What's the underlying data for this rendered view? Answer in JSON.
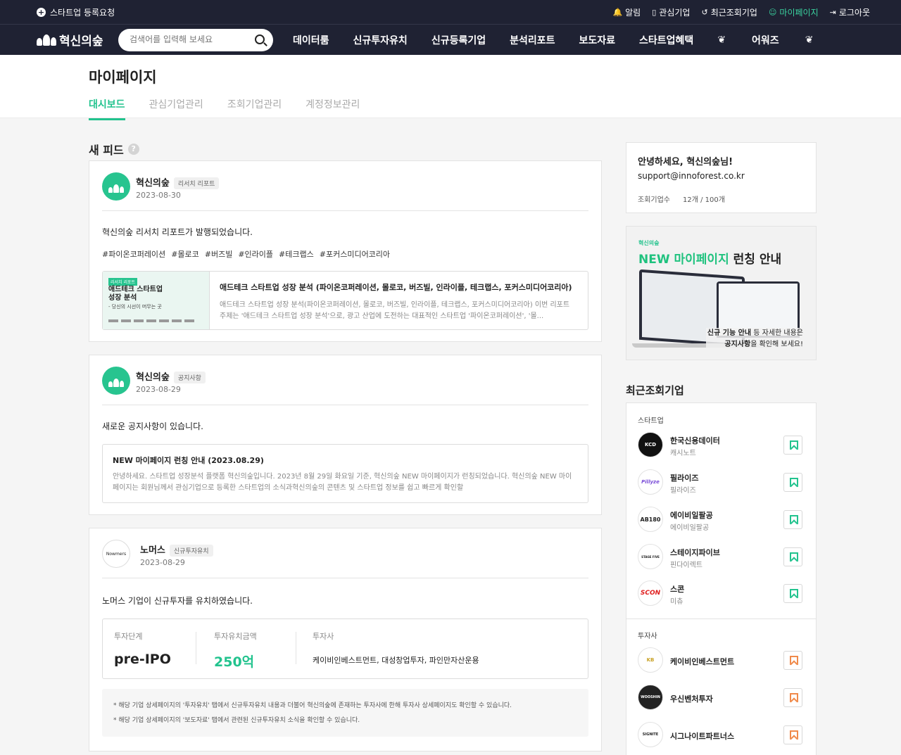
{
  "topbar": {
    "register": "스타트업 등록요청",
    "links": [
      {
        "icon": "bell-icon",
        "label": "알림"
      },
      {
        "icon": "bookmark-icon",
        "label": "관심기업"
      },
      {
        "icon": "history-icon",
        "label": "최근조회기업"
      },
      {
        "icon": "user-icon",
        "label": "마이페이지"
      },
      {
        "icon": "logout-icon",
        "label": "로그아웃"
      }
    ]
  },
  "nav": {
    "logo": "혁신의숲",
    "search_placeholder": "검색어를 입력해 보세요",
    "menu": [
      "데이터룸",
      "신규투자유치",
      "신규등록기업",
      "분석리포트",
      "보도자료",
      "스타트업혜택",
      "어워즈"
    ]
  },
  "page": {
    "title": "마이페이지",
    "tabs": [
      "대시보드",
      "관심기업관리",
      "조회기업관리",
      "계정정보관리"
    ]
  },
  "feed": {
    "title": "새 피드",
    "help": "?",
    "items": [
      {
        "author": "혁신의숲",
        "badge": "리서치 리포트",
        "date": "2023-08-30",
        "message": "혁신의숲 리서치 리포트가 발행되었습니다.",
        "tags": [
          "#파이온코퍼레이션",
          "#몰로코",
          "#버즈빌",
          "#인라이플",
          "#테크랩스",
          "#포커스미디어코리아"
        ],
        "thumb": {
          "label": "리서치 리포트",
          "title_line1": "애드테크 스타트업",
          "title_line2": "성장 분석",
          "sub": "- 당신의 시선이 머무는 곳"
        },
        "link_title": "애드테크 스타트업 성장 분석 (파이온코퍼레이션, 몰로코, 버즈빌, 인라이플, 테크랩스, 포커스미디어코리아)",
        "link_desc": "애드테크 스타트업 성장 분석(파이온코퍼레이션, 몰로코, 버즈빌, 인라이플, 테크랩스, 포커스미디어코리아) 이번 리포트 주제는 '애드테크 스타트업 성장 분석'으로, 광고 산업에 도전하는 대표적인 스타트업 '파이온코퍼레이션', '몰..."
      },
      {
        "author": "혁신의숲",
        "badge": "공지사항",
        "date": "2023-08-29",
        "message": "새로운 공지사항이 있습니다.",
        "notice_title": "NEW 마이페이지 런칭 안내 (2023.08.29)",
        "notice_desc": "안녕하세요. 스타트업 성장분석 플랫폼 혁신의숲입니다. 2023년 8월 29일 화요일 기준, 혁신의숲 NEW 마이페이지가 런칭되었습니다. 혁신의숲 NEW 마이페이지는 회원님께서 관심기업으로 등록한 스타트업의 소식과혁신의숲의 콘텐츠 및 스타트업 정보를 쉽고 빠르게 확인할"
      },
      {
        "author": "노머스",
        "badge": "신규투자유치",
        "date": "2023-08-29",
        "logo_text": "Nowmers",
        "message": "노머스 기업이 신규투자를 유치하였습니다.",
        "invest": {
          "stage_label": "투자단계",
          "stage_value": "pre-IPO",
          "amount_label": "투자유치금액",
          "amount_value": "250억",
          "investors_label": "투자사",
          "investors_value": "케이비인베스트먼트, 대성창업투자, 파인만자산운용"
        },
        "notes": [
          "* 해당 기업 상세페이지의 '투자유치' 탭에서 신규투자유치 내용과 더불어 혁신의숲에 존재하는 투자사에 한해 투자사 상세페이지도 확인할 수 있습니다.",
          "* 해당 기업 상세페이지의 '보도자료' 탭에서 관련된 신규투자유치 소식을 확인할 수 있습니다."
        ]
      }
    ]
  },
  "profile": {
    "greeting": "안녕하세요, 혁신의숲님!",
    "email": "support@innoforest.co.kr",
    "count_label": "조회기업수",
    "count_value": "12개 / 100개"
  },
  "banner": {
    "logo": "혁신의숲",
    "title_prefix": "NEW 마이페이지",
    "title_suffix": " 런칭 안내",
    "desc_line1_bold": "신규 기능 안내",
    "desc_line1_rest": " 등 자세한 내용은",
    "desc_line2_bold": "공지사항",
    "desc_line2_rest": "을 확인해 보세요!"
  },
  "recent": {
    "title": "최근조회기업",
    "startup_label": "스타트업",
    "investor_label": "투자사",
    "startups": [
      {
        "name": "한국신용데이터",
        "sub": "캐시노트",
        "logo": "KCD",
        "logo_bg": "#111111",
        "logo_fg": "#ffffff"
      },
      {
        "name": "필라이즈",
        "sub": "필라이즈",
        "logo": "Pillyze",
        "logo_bg": "#ffffff",
        "logo_fg": "#7a4dd8"
      },
      {
        "name": "에이비일팔공",
        "sub": "에이비일팔공",
        "logo": "AB180",
        "logo_bg": "#ffffff",
        "logo_fg": "#222222"
      },
      {
        "name": "스테이지파이브",
        "sub": "핀다이렉트",
        "logo": "STAGE FIVE",
        "logo_bg": "#ffffff",
        "logo_fg": "#222222"
      },
      {
        "name": "스콘",
        "sub": "미츄",
        "logo": "SCON",
        "logo_bg": "#ffffff",
        "logo_fg": "#e02020"
      }
    ],
    "investors": [
      {
        "name": "케이비인베스트먼트",
        "logo": "KB",
        "logo_bg": "#ffffff",
        "logo_fg": "#c9a227"
      },
      {
        "name": "우신벤처투자",
        "logo": "WOOSHIN",
        "logo_bg": "#222222",
        "logo_fg": "#ffffff"
      },
      {
        "name": "시그나이트파트너스",
        "logo": "SIGNITE",
        "logo_bg": "#ffffff",
        "logo_fg": "#222222"
      }
    ]
  },
  "colors": {
    "accent": "#22c38e",
    "nav_bg": "#1f2233",
    "investor_bookmark": "#f08a4b"
  }
}
